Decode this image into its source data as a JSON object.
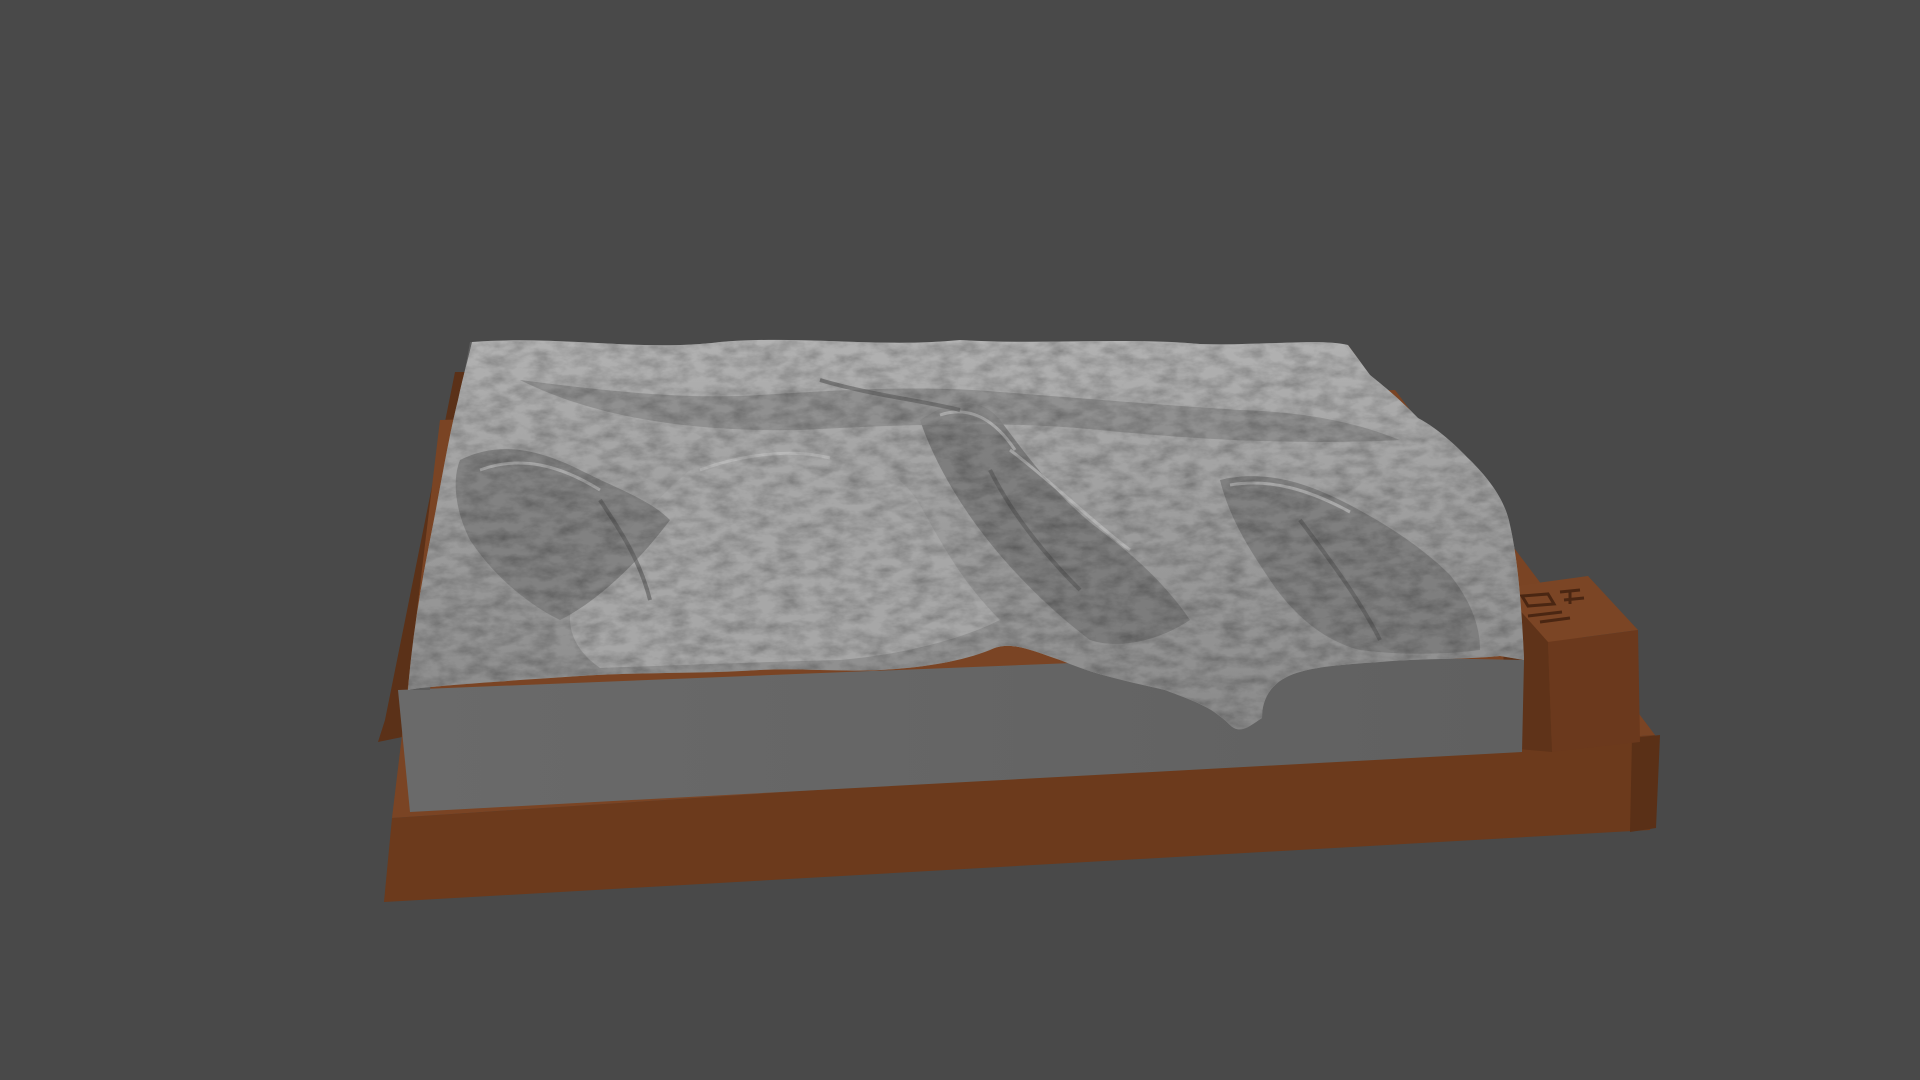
{
  "scene": {
    "subject": "terrain-relief-model",
    "colors": {
      "background": "#494949",
      "terrain_light": "#a9a9a9",
      "terrain_mid": "#8f8f8f",
      "terrain_dark": "#5f5f5f",
      "side_wall": "#656565",
      "base_wood_top": "#7a4424",
      "base_wood_front": "#6a3a1d",
      "base_wood_side": "#5b3118"
    }
  }
}
